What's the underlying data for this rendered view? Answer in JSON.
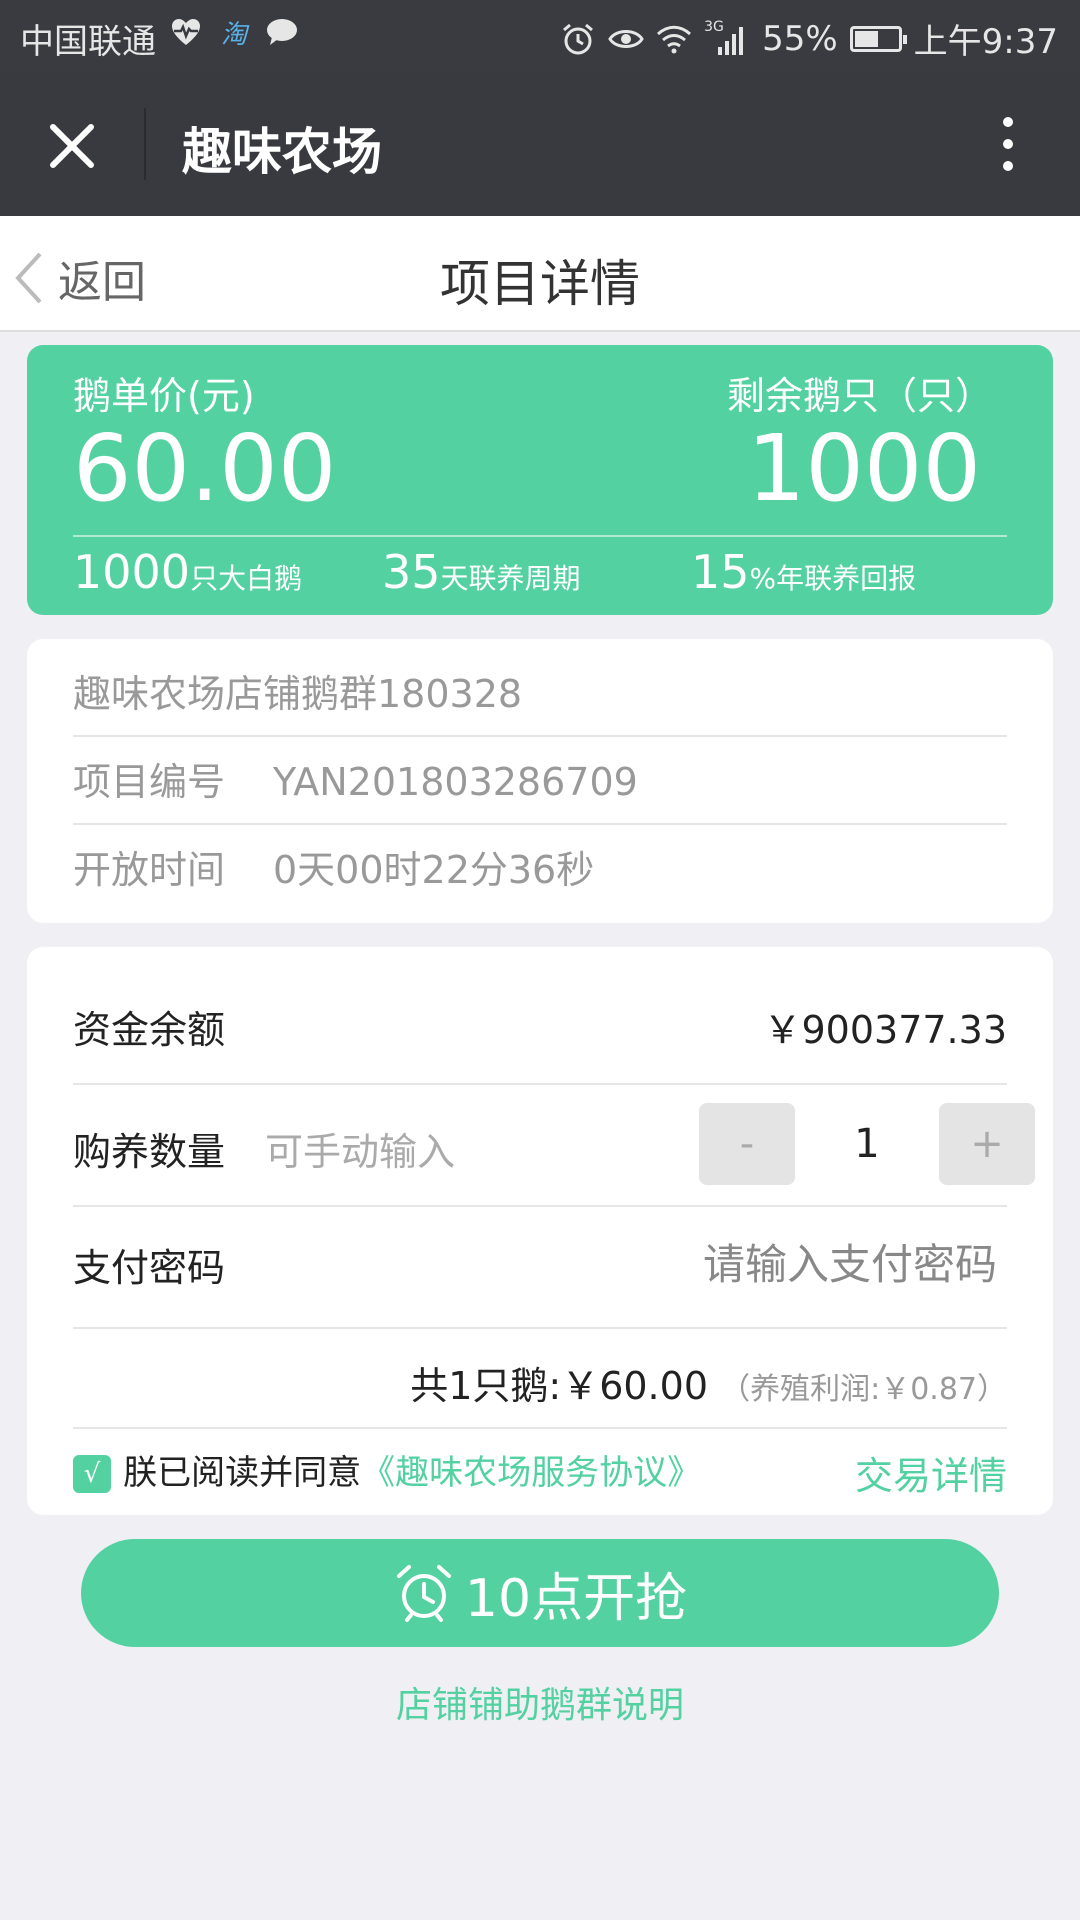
{
  "status_bar": {
    "carrier": "中国联通",
    "taobao_glyph": "淘",
    "battery_level": 0.55,
    "battery_text": "55%",
    "network": "3G",
    "time": "上午9:37",
    "icons": [
      "heart-pulse-icon",
      "taobao-icon",
      "chat-bubble-icon",
      "alarm-icon",
      "eye-icon",
      "wifi-icon",
      "signal-icon",
      "battery-icon"
    ]
  },
  "title_bar": {
    "app_title": "趣味农场"
  },
  "page_header": {
    "back_label": "返回",
    "title": "项目详情"
  },
  "hero": {
    "price_label": "鹅单价(元)",
    "price_value": "60.00",
    "stock_label": "剩余鹅只（只）",
    "stock_value": "1000",
    "stats": [
      {
        "num": "1000",
        "unit": "只大白鹅"
      },
      {
        "num": "35",
        "unit": "天联养周期"
      },
      {
        "num": "15",
        "unit": "%年联养回报"
      }
    ]
  },
  "info": {
    "name": "趣味农场店铺鹅群180328",
    "project_no_label": "项目编号",
    "project_no": "YAN201803286709",
    "open_time_label": "开放时间",
    "open_time": "0天00时22分36秒"
  },
  "purchase": {
    "balance_label": "资金余额",
    "balance_value": "￥900377.33",
    "quantity_label": "购养数量",
    "quantity_hint": "可手动输入",
    "minus": "-",
    "quantity": "1",
    "plus": "+",
    "password_label": "支付密码",
    "password_placeholder": "请输入支付密码",
    "summary_prefix": "共",
    "summary_count": "1",
    "summary_unit": "只鹅:",
    "summary_price": "￥60.00",
    "summary_profit": "（养殖利润:￥0.87）",
    "agree_check": "√",
    "agree_text": "朕已阅读并同意",
    "agreement_link": "《趣味农场服务协议》",
    "trade_detail": "交易详情"
  },
  "cta": {
    "label": "10点开抢"
  },
  "footer": {
    "link": "店铺铺助鹅群说明"
  },
  "colors": {
    "accent": "#53d1a1",
    "titlebar": "#393a3f",
    "background": "#efeff4"
  }
}
